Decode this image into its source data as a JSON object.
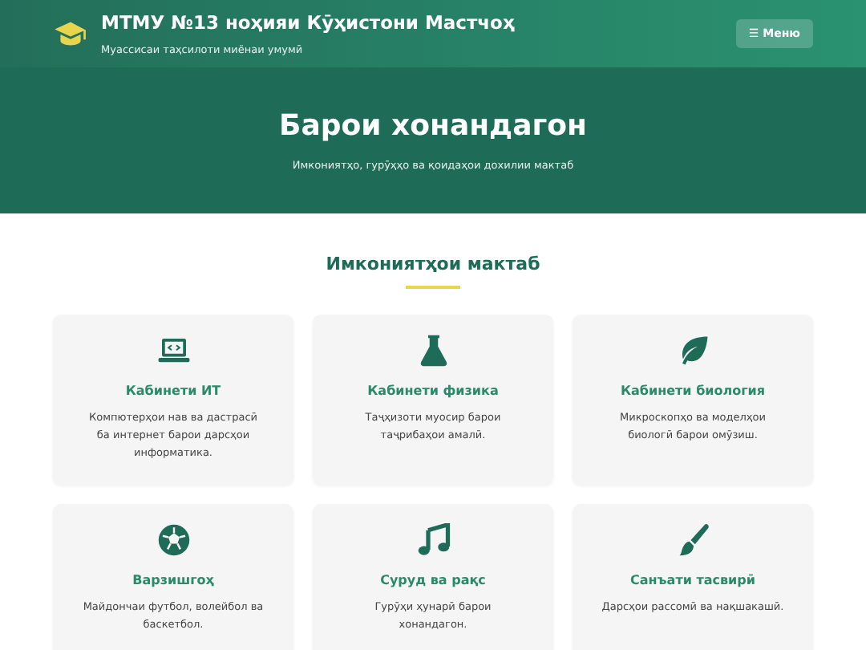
{
  "header": {
    "title": "МТМУ №13 ноҳияи Кӯҳистони Мастчоҳ",
    "subtitle": "Муассисаи таҳсилоти миёнаи умумӣ",
    "menu_button": "☰ Меню"
  },
  "hero": {
    "title": "Барои хонандагон",
    "subtitle": "Имкониятҳо, гурӯҳҳо ва қоидаҳои дохилии мактаб"
  },
  "section": {
    "title": "Имкониятҳои мактаб"
  },
  "cards": [
    {
      "kind": "laptop",
      "title": "Кабинети ИТ",
      "text": "Компютерҳои нав ва дастрасӣ ба интернет барои дарсҳои информатика."
    },
    {
      "kind": "flask",
      "title": "Кабинети физика",
      "text": "Таҷҳизоти муосир барои таҷрибаҳои амалӣ."
    },
    {
      "kind": "leaf",
      "title": "Кабинети биология",
      "text": "Микроскопҳо ва моделҳои биологӣ барои омӯзиш."
    },
    {
      "kind": "ball",
      "title": "Варзишгоҳ",
      "text": "Майдончаи футбол, волейбол ва баскетбол."
    },
    {
      "kind": "music",
      "title": "Суруд ва рақс",
      "text": "Гурӯҳи ҳунарӣ барои хонандагон."
    },
    {
      "kind": "brush",
      "title": "Санъати тасвирӣ",
      "text": "Дарсҳои рассомӣ ва нақшакашӣ."
    }
  ]
}
